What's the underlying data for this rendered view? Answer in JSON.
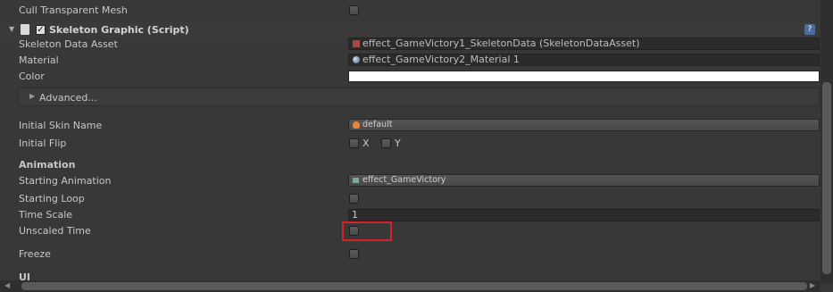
{
  "component": {
    "title": "Skeleton Graphic (Script)",
    "enabled": true
  },
  "fields": {
    "cull_transparent_mesh": {
      "label": "Cull Transparent Mesh",
      "checked": false
    },
    "skeleton_data_asset": {
      "label": "Skeleton Data Asset",
      "value": "effect_GameVictory1_SkeletonData (SkeletonDataAsset)"
    },
    "material": {
      "label": "Material",
      "value": "effect_GameVictory2_Material 1"
    },
    "color": {
      "label": "Color",
      "value": "#ffffff"
    },
    "advanced": {
      "label": "Advanced..."
    },
    "initial_skin_name": {
      "label": "Initial Skin Name",
      "value": "default"
    },
    "initial_flip": {
      "label": "Initial Flip",
      "x_label": "X",
      "y_label": "Y",
      "x": false,
      "y": false
    },
    "animation_header": "Animation",
    "starting_animation": {
      "label": "Starting Animation",
      "value": "effect_GameVictory"
    },
    "starting_loop": {
      "label": "Starting Loop",
      "checked": false
    },
    "time_scale": {
      "label": "Time Scale",
      "value": "1"
    },
    "unscaled_time": {
      "label": "Unscaled Time",
      "checked": false
    },
    "freeze": {
      "label": "Freeze",
      "checked": false
    },
    "ui_header": "UI"
  },
  "colors": {
    "highlight": "#d8222b",
    "background": "#383838"
  }
}
